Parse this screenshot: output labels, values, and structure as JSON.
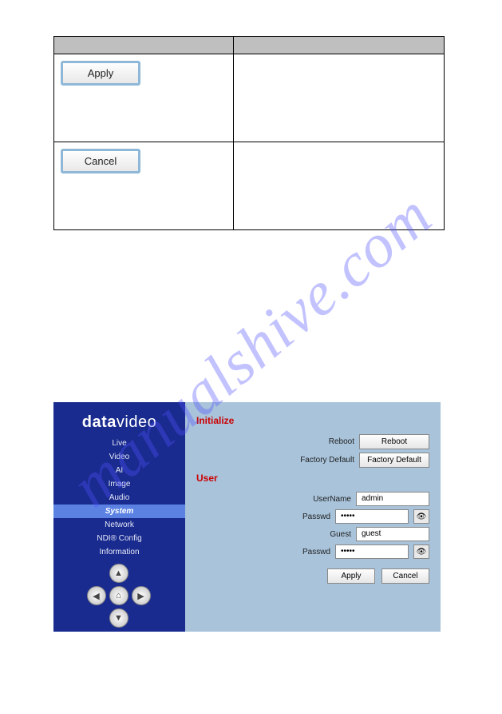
{
  "watermark": "manualshive.com",
  "top_table": {
    "apply_label": "Apply",
    "cancel_label": "Cancel"
  },
  "sidebar": {
    "logo_bold": "data",
    "logo_light": "video",
    "menu": [
      "Live",
      "Video",
      "AI",
      "Image",
      "Audio",
      "System",
      "Network",
      "NDI® Config",
      "Information"
    ],
    "active_index": 5,
    "dpad": {
      "up": "▲",
      "down": "▼",
      "left": "◀",
      "right": "▶",
      "home": "⌂"
    }
  },
  "content": {
    "initialize_title": "Initialize",
    "reboot_label": "Reboot",
    "reboot_button": "Reboot",
    "factory_label": "Factory Default",
    "factory_button": "Factory Default",
    "user_title": "User",
    "username_label": "UserName",
    "username_value": "admin",
    "passwd1_label": "Passwd",
    "passwd1_value": "•••••",
    "guest_label": "Guest",
    "guest_value": "guest",
    "passwd2_label": "Passwd",
    "passwd2_value": "•••••",
    "apply_label": "Apply",
    "cancel_label": "Cancel"
  }
}
